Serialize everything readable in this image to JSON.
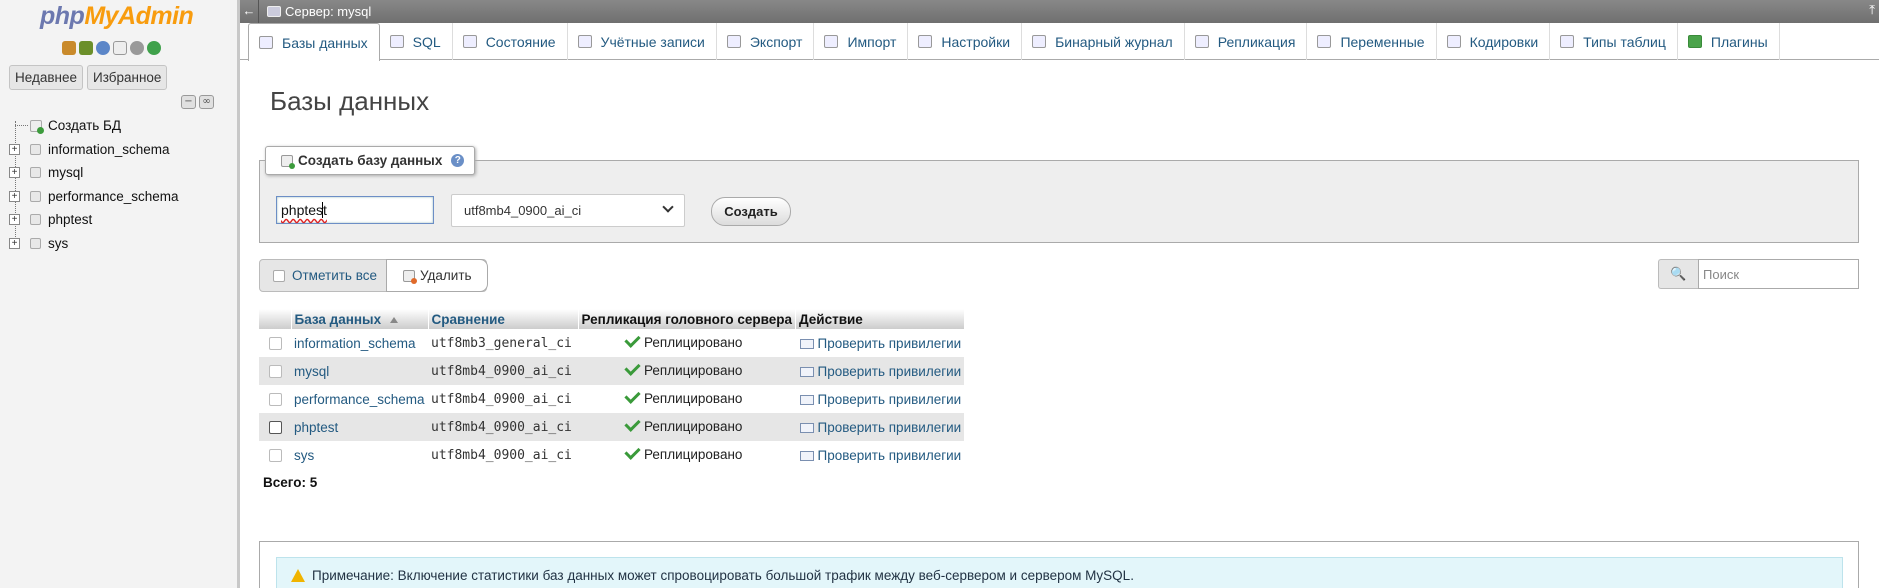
{
  "app": {
    "logo_php": "php",
    "logo_rest": "MyAdmin"
  },
  "sidebar": {
    "recent_label": "Недавнее",
    "favorites_label": "Избранное",
    "create_db_label": "Создать БД",
    "databases": [
      "information_schema",
      "mysql",
      "performance_schema",
      "phptest",
      "sys"
    ]
  },
  "topbar": {
    "back": "←",
    "server_label": "Сервер: mysql",
    "collapse": "⤒"
  },
  "tabs": [
    {
      "label": "Базы данных",
      "active": true
    },
    {
      "label": "SQL"
    },
    {
      "label": "Состояние"
    },
    {
      "label": "Учётные записи"
    },
    {
      "label": "Экспорт"
    },
    {
      "label": "Импорт"
    },
    {
      "label": "Настройки"
    },
    {
      "label": "Бинарный журнал"
    },
    {
      "label": "Репликация"
    },
    {
      "label": "Переменные"
    },
    {
      "label": "Кодировки"
    },
    {
      "label": "Типы таблиц"
    },
    {
      "label": "Плагины"
    }
  ],
  "main": {
    "title": "Базы данных",
    "create": {
      "legend": "Создать базу данных",
      "help": "?",
      "db_name_value": "phptest",
      "collation_value": "utf8mb4_0900_ai_ci",
      "create_button": "Создать"
    },
    "bulk": {
      "select_all": "Отметить все",
      "delete": "Удалить"
    },
    "search": {
      "icon": "🔍",
      "placeholder": "Поиск"
    },
    "table": {
      "headers": {
        "name": "База данных",
        "collation": "Сравнение",
        "replication": "Репликация головного сервера",
        "action": "Действие"
      },
      "rows": [
        {
          "name": "information_schema",
          "collation": "utf8mb3_general_ci",
          "replication": "Реплицировано",
          "action": "Проверить привилегии"
        },
        {
          "name": "mysql",
          "collation": "utf8mb4_0900_ai_ci",
          "replication": "Реплицировано",
          "action": "Проверить привилегии"
        },
        {
          "name": "performance_schema",
          "collation": "utf8mb4_0900_ai_ci",
          "replication": "Реплицировано",
          "action": "Проверить привилегии"
        },
        {
          "name": "phptest",
          "collation": "utf8mb4_0900_ai_ci",
          "replication": "Реплицировано",
          "action": "Проверить привилегии"
        },
        {
          "name": "sys",
          "collation": "utf8mb4_0900_ai_ci",
          "replication": "Реплицировано",
          "action": "Проверить привилегии"
        }
      ],
      "total": "Всего: 5"
    },
    "note": "Примечание: Включение статистики баз данных может спровоцировать большой трафик между веб-сервером и сервером MySQL."
  }
}
